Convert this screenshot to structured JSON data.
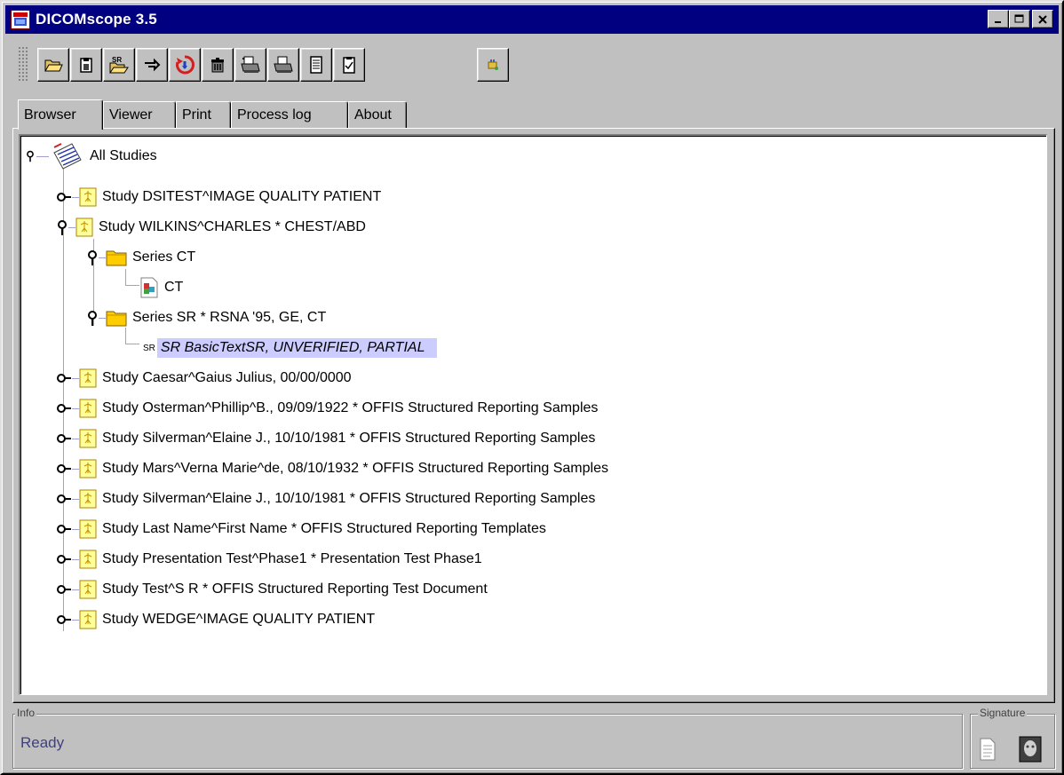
{
  "window": {
    "title": "DICOMscope 3.5",
    "controls": {
      "minimize": "_",
      "maximize": "□",
      "close": "✕"
    }
  },
  "toolbar": {
    "buttons": [
      {
        "icon": "open-folder-icon"
      },
      {
        "icon": "clipboard-icon"
      },
      {
        "icon": "open-sr-icon"
      },
      {
        "icon": "send-icon"
      },
      {
        "icon": "refresh-icon"
      },
      {
        "icon": "trash-icon"
      },
      {
        "icon": "print-spool-icon"
      },
      {
        "icon": "printer-icon"
      },
      {
        "icon": "document-icon"
      },
      {
        "icon": "checklist-icon"
      },
      {
        "icon": "tool-icon"
      }
    ]
  },
  "tabs": [
    {
      "label": "Browser",
      "active": true
    },
    {
      "label": "Viewer",
      "active": false
    },
    {
      "label": "Print",
      "active": false
    },
    {
      "label": "Process log",
      "active": false
    },
    {
      "label": "About",
      "active": false
    }
  ],
  "tree": {
    "root": {
      "label": "All Studies",
      "expanded": true
    },
    "nodes": [
      {
        "kind": "study",
        "label": "Study DSITEST^IMAGE QUALITY PATIENT",
        "expanded": false
      },
      {
        "kind": "study",
        "label": "Study WILKINS^CHARLES * CHEST/ABD",
        "expanded": true
      },
      {
        "kind": "series",
        "label": "Series CT",
        "expanded": true
      },
      {
        "kind": "image",
        "label": "CT"
      },
      {
        "kind": "series",
        "label": "Series SR * RSNA '95, GE, CT",
        "expanded": true
      },
      {
        "kind": "sr",
        "badge": "SR",
        "label": "SR BasicTextSR, UNVERIFIED, PARTIAL",
        "selected": true
      },
      {
        "kind": "study",
        "label": "Study Caesar^Gaius Julius, 00/00/0000",
        "expanded": false
      },
      {
        "kind": "study",
        "label": "Study Osterman^Phillip^B., 09/09/1922 * OFFIS Structured Reporting Samples",
        "expanded": false
      },
      {
        "kind": "study",
        "label": "Study Silverman^Elaine J., 10/10/1981 * OFFIS Structured Reporting Samples",
        "expanded": false
      },
      {
        "kind": "study",
        "label": "Study Mars^Verna Marie^de, 08/10/1932 * OFFIS Structured Reporting Samples",
        "expanded": false
      },
      {
        "kind": "study",
        "label": "Study Silverman^Elaine J., 10/10/1981 * OFFIS Structured Reporting Samples",
        "expanded": false
      },
      {
        "kind": "study",
        "label": "Study Last Name^First Name * OFFIS Structured Reporting Templates",
        "expanded": false
      },
      {
        "kind": "study",
        "label": "Study Presentation Test^Phase1 * Presentation Test Phase1",
        "expanded": false
      },
      {
        "kind": "study",
        "label": "Study Test^S R * OFFIS Structured Reporting Test Document",
        "expanded": false
      },
      {
        "kind": "study",
        "label": "Study WEDGE^IMAGE QUALITY PATIENT",
        "expanded": false
      }
    ]
  },
  "status": {
    "info_title": "Info",
    "info_text": "Ready",
    "signature_title": "Signature",
    "signature_icons": [
      "document-icon",
      "face-icon"
    ]
  },
  "colors": {
    "titlebar": "#000080",
    "face": "#c0c0c0",
    "selection": "#ccccff",
    "folder": "#ffcc00",
    "study_box": "#ffff99"
  }
}
